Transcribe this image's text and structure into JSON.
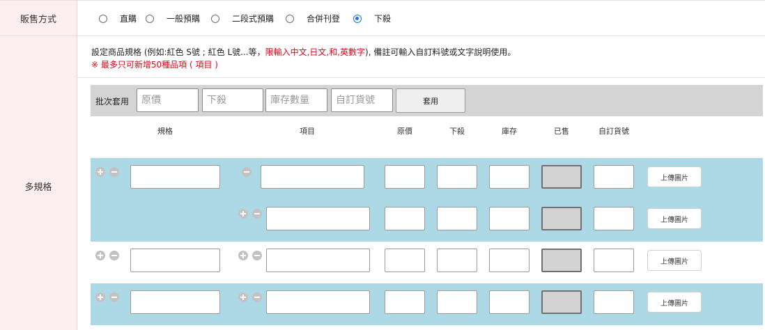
{
  "sale_method": {
    "label": "販售方式",
    "options": [
      "直購",
      "一般預購",
      "二段式預購",
      "合併刊登",
      "下殺"
    ],
    "selected": "下殺"
  },
  "multi_spec": {
    "label": "多規格",
    "description_prefix": "設定商品規格 (例如:紅色 S號 ; 紅色 L號...等，",
    "description_red": "限輸入中文,日文,和,英數字",
    "description_suffix": "), 備註可輸入自訂料號或文字說明使用。",
    "limit_note": "※ 最多只可新增50種品項 ( 項目 )",
    "batch": {
      "label": "批次套用",
      "placeholders": [
        "原價",
        "下殺",
        "庫存數量",
        "自訂貨號"
      ],
      "apply_button": "套用"
    },
    "columns": [
      "規格",
      "項目",
      "原價",
      "下殺",
      "庫存",
      "已售",
      "自訂貨號"
    ],
    "upload_label": "上傳圖片"
  },
  "colors": {
    "accent": "#1a73e8",
    "label_bg": "#fdeef0",
    "band": "#add8e6",
    "warning": "#e60012"
  }
}
